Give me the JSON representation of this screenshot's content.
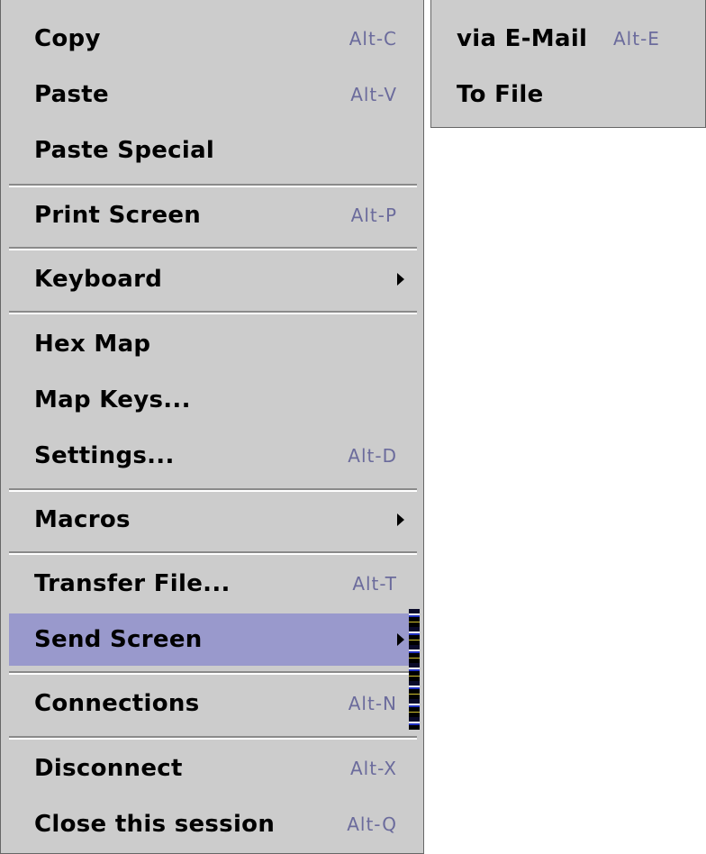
{
  "main_menu": {
    "items": [
      {
        "label": "Copy",
        "accel": "Alt-C"
      },
      {
        "label": "Paste",
        "accel": "Alt-V"
      },
      {
        "label": "Paste Special",
        "accel": ""
      },
      {
        "label": "Print Screen",
        "accel": "Alt-P"
      },
      {
        "label": "Keyboard",
        "accel": ""
      },
      {
        "label": "Hex Map",
        "accel": ""
      },
      {
        "label": "Map Keys...",
        "accel": ""
      },
      {
        "label": "Settings...",
        "accel": "Alt-D"
      },
      {
        "label": "Macros",
        "accel": ""
      },
      {
        "label": "Transfer File...",
        "accel": "Alt-T"
      },
      {
        "label": "Send Screen",
        "accel": ""
      },
      {
        "label": "Connections",
        "accel": "Alt-N"
      },
      {
        "label": "Disconnect",
        "accel": "Alt-X"
      },
      {
        "label": "Close this session",
        "accel": "Alt-Q"
      }
    ]
  },
  "sub_menu": {
    "items": [
      {
        "label": "via E-Mail",
        "accel": "Alt-E"
      },
      {
        "label": "To File",
        "accel": ""
      }
    ]
  },
  "colors": {
    "menu_background": "#cccccc",
    "selection": "#9999cc",
    "accelerator_text": "#6b6b9c"
  }
}
